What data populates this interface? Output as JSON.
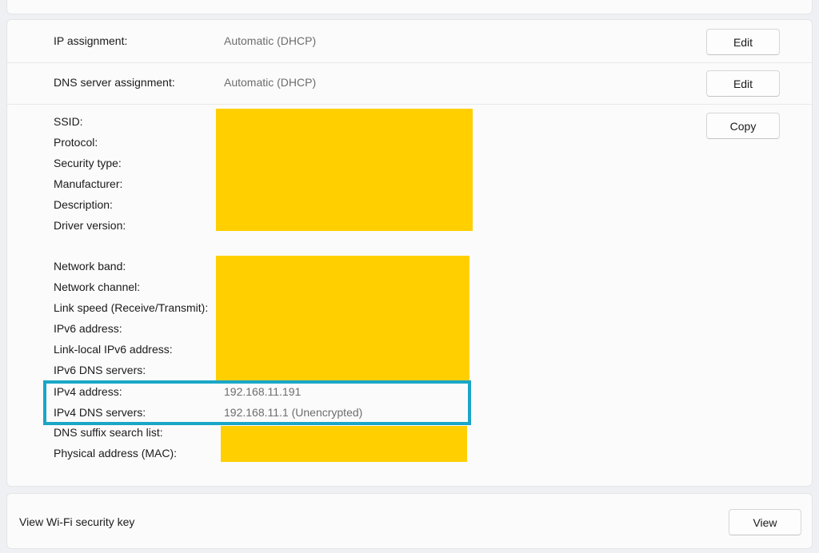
{
  "props": {
    "ip_assignment": {
      "label": "IP assignment:",
      "value": "Automatic (DHCP)",
      "button": "Edit"
    },
    "dns_assignment": {
      "label": "DNS server assignment:",
      "value": "Automatic (DHCP)",
      "button": "Edit"
    },
    "copy_button": "Copy",
    "group1": [
      "SSID:",
      "Protocol:",
      "Security type:",
      "Manufacturer:",
      "Description:",
      "Driver version:"
    ],
    "group2": [
      "Network band:",
      "Network channel:",
      "Link speed (Receive/Transmit):",
      "IPv6 address:",
      "Link-local IPv6 address:",
      "IPv6 DNS servers:"
    ],
    "ipv4_address": {
      "label": "IPv4 address:",
      "value": "192.168.11.191"
    },
    "ipv4_dns": {
      "label": "IPv4 DNS servers:",
      "value": "192.168.11.1 (Unencrypted)"
    },
    "group3": [
      "DNS suffix search list:",
      "Physical address (MAC):"
    ]
  },
  "footer": {
    "label": "View Wi-Fi security key",
    "button": "View"
  },
  "colors": {
    "redaction": "#ffcf00",
    "highlight": "#1aa6c7"
  }
}
